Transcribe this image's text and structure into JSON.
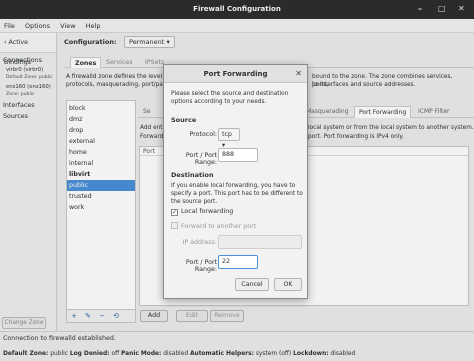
{
  "window": {
    "title": "Firewall Configuration"
  },
  "menu": {
    "file": "File",
    "options": "Options",
    "view": "View",
    "help": "Help"
  },
  "sidebar": {
    "toggle": "Active Bindings",
    "connections": "Connections",
    "conn1_name": "virbr0 (virbr0)",
    "conn1_zone": "Default Zone: public",
    "conn2_name": "ens160 (ens160)",
    "conn2_zone": "Zone: public",
    "interfaces": "Interfaces",
    "sources": "Sources",
    "change_zone": "Change Zone"
  },
  "config": {
    "label": "Configuration:",
    "value": "Permanent"
  },
  "tabs": {
    "zones": "Zones",
    "services": "Services",
    "ipsets": "IPSets"
  },
  "zone_desc": {
    "line1": "A firewalld zone defines the level of trust",
    "line1b": "bound to the zone. The zone combines services, ports,",
    "line2": "protocols, masquerading, port/packet forwarding",
    "line2b": "to interfaces and source addresses."
  },
  "zones": [
    "block",
    "dmz",
    "drop",
    "external",
    "home",
    "internal",
    "libvirt",
    "public",
    "trusted",
    "work"
  ],
  "subtabs": {
    "s": "Se",
    "masq": "Masquerading",
    "pf": "Port Forwarding",
    "icmp": "ICMP Filter"
  },
  "panel": {
    "l1a": "Add entri",
    "l1b": "local system or from the local system to another system.",
    "l2a": "Forwardi",
    "l2b": "port. Port forwarding is IPv4 only.",
    "col_port": "Port",
    "col_p": "P"
  },
  "buttons": {
    "add": "Add",
    "edit": "Edit",
    "remove": "Remove"
  },
  "status": {
    "line1": "Connection to firewalld established.",
    "default_zone_label": "Default Zone:",
    "default_zone": "public",
    "log_denied_label": "Log Denied:",
    "log_denied": "off",
    "panic_label": "Panic Mode:",
    "panic": "disabled",
    "helpers_label": "Automatic Helpers:",
    "helpers": "system (off)",
    "lockdown_label": "Lockdown:",
    "lockdown": "disabled"
  },
  "dialog": {
    "title": "Port Forwarding",
    "intro": "Please select the source and destination options according to your needs.",
    "source_heading": "Source",
    "protocol_label": "Protocol:",
    "protocol_value": "tcp",
    "port_label": "Port / Port Range:",
    "port_value": "888",
    "dest_heading": "Destination",
    "dest_text": "If you enable local forwarding, you have to specify a port. This port has to be different to the source port.",
    "local_fwd": "Local forwarding",
    "other_port": "Forward to another port",
    "ip_label": "IP address:",
    "ip_value": "",
    "dest_port_label": "Port / Port Range:",
    "dest_port_value": "22",
    "cancel": "Cancel",
    "ok": "OK"
  },
  "colors": {
    "selection": "#4a90d9",
    "titlebar": "#2b2b2b"
  }
}
